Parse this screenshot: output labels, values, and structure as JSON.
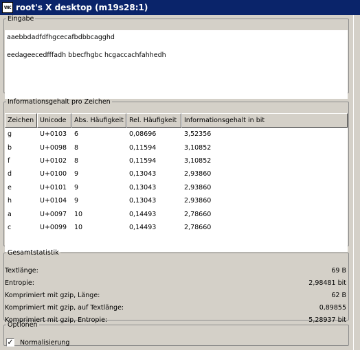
{
  "window": {
    "app_icon_text": "VNC",
    "title": "root's X desktop (m19s28:1)"
  },
  "eingabe": {
    "legend": "Eingabe",
    "lines": [
      "aaebbdadfdfhgcecafbdbbcagghd",
      "",
      "eedageecedfffadh bbecfhgbc hcgaccachfahhedh"
    ]
  },
  "info": {
    "legend": "Informationsgehalt pro Zeichen",
    "columns": [
      "Zeichen",
      "Unicode",
      "Abs. Häufigkeit",
      "Rel. Häufigkeit",
      "Informationsgehalt in bit"
    ],
    "rows": [
      [
        "g",
        "U+0103",
        "6",
        "0,08696",
        "3,52356"
      ],
      [
        "b",
        "U+0098",
        "8",
        "0,11594",
        "3,10852"
      ],
      [
        "f",
        "U+0102",
        "8",
        "0,11594",
        "3,10852"
      ],
      [
        "d",
        "U+0100",
        "9",
        "0,13043",
        "2,93860"
      ],
      [
        "e",
        "U+0101",
        "9",
        "0,13043",
        "2,93860"
      ],
      [
        "h",
        "U+0104",
        "9",
        "0,13043",
        "2,93860"
      ],
      [
        "a",
        "U+0097",
        "10",
        "0,14493",
        "2,78660"
      ],
      [
        "c",
        "U+0099",
        "10",
        "0,14493",
        "2,78660"
      ]
    ]
  },
  "stats": {
    "legend": "Gesamtstatistik",
    "rows": [
      {
        "label": "Textlänge:",
        "value": "69 B"
      },
      {
        "label": "Entropie:",
        "value": "2,98481 bit"
      },
      {
        "label": "Komprimiert mit gzip, Länge:",
        "value": "62 B"
      },
      {
        "label": "Komprimiert mit gzip, auf Textlänge:",
        "value": "0,89855"
      },
      {
        "label": "Komprimiert mit gzip, Entropie:",
        "value": "5,28937 bit"
      }
    ]
  },
  "options": {
    "legend": "Optionen",
    "normalisierung_label": "Normalisierung",
    "normalisierung_checked": true,
    "check_glyph": "✓"
  },
  "colors": {
    "titlebar": "#0a246a",
    "window_bg": "#d4d0c8"
  }
}
